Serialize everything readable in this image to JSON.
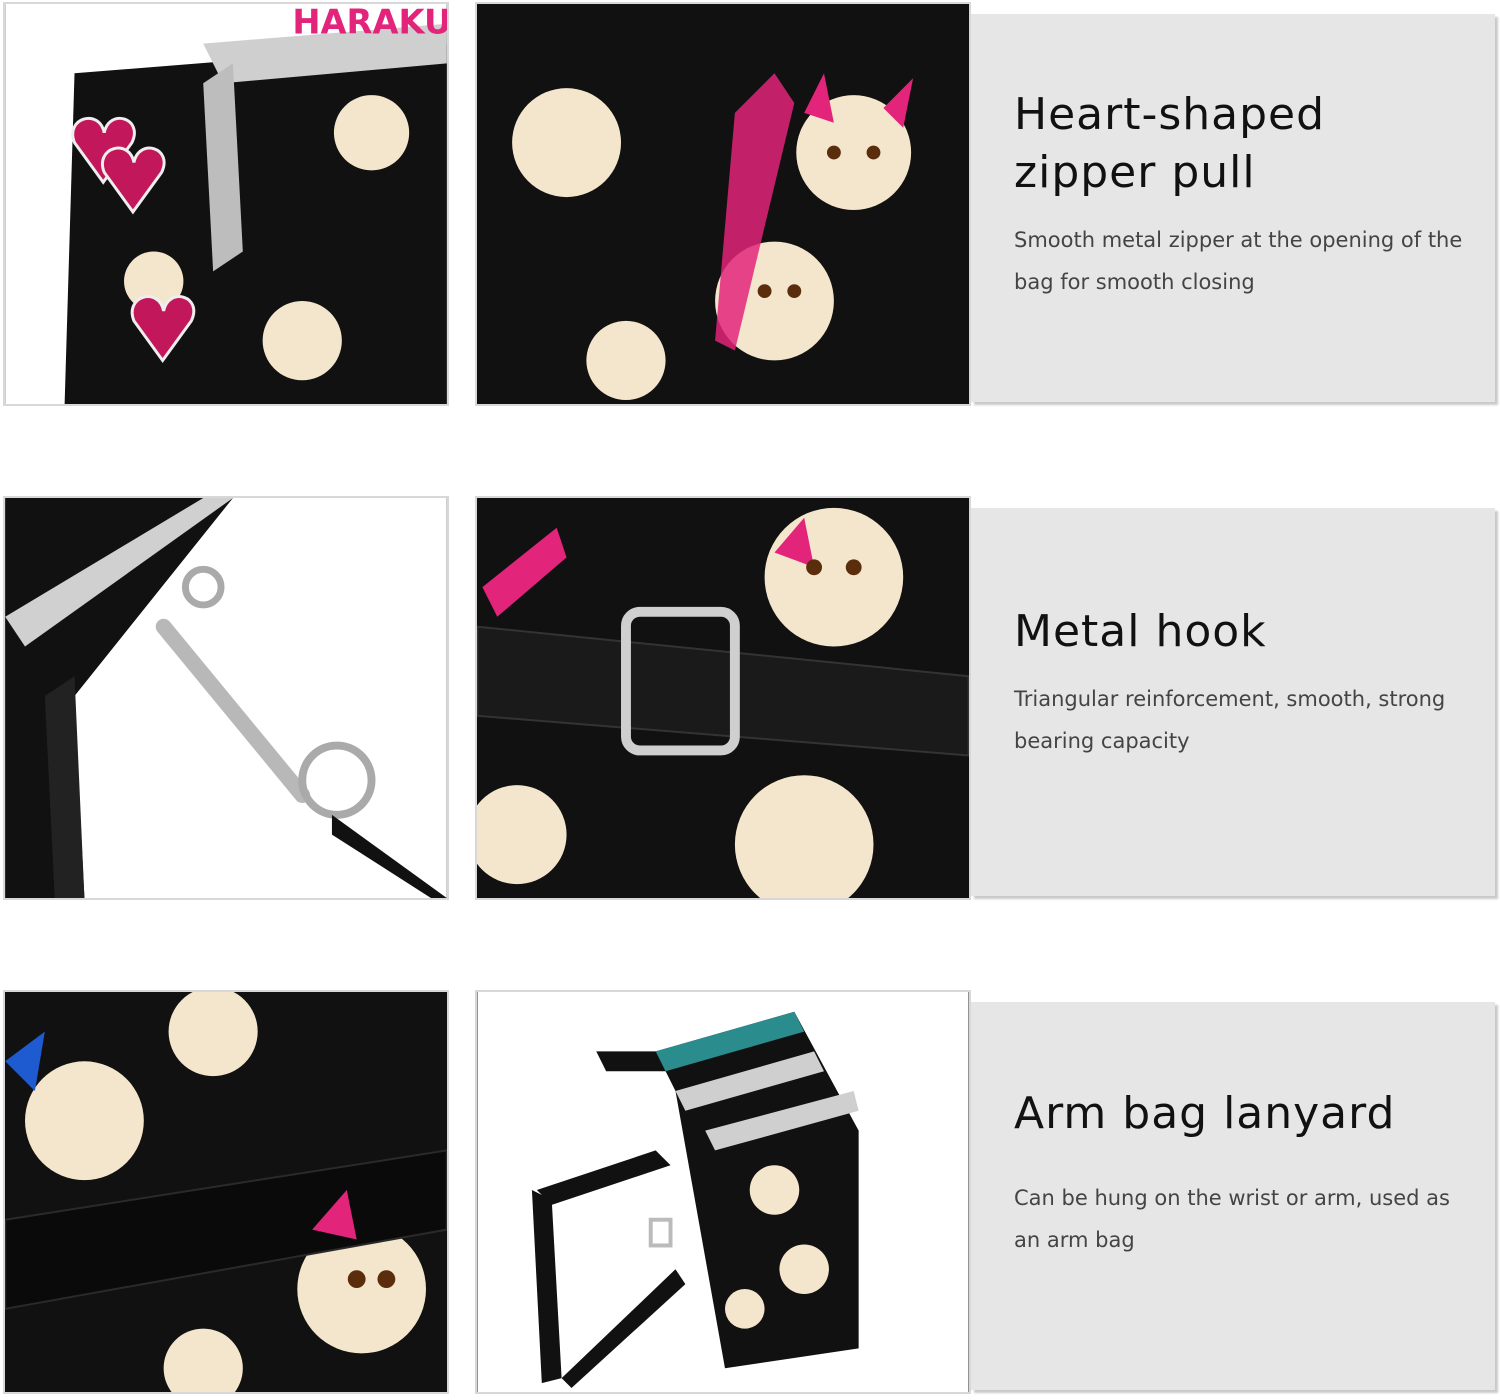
{
  "features": [
    {
      "title": "Heart-shaped zipper pull",
      "description": "Smooth metal zipper at the opening of the bag for smooth closing"
    },
    {
      "title": "Metal hook",
      "description": "Triangular reinforcement, smooth, strong bearing capacity"
    },
    {
      "title": "Arm bag lanyard",
      "description": "Can be hung on the wrist or arm, used as an arm bag"
    }
  ],
  "colors": {
    "panel": "#e6e6e6",
    "fabric": "#111111",
    "accent_pink": "#e2247a",
    "cat_cream": "#f4e6cc"
  }
}
